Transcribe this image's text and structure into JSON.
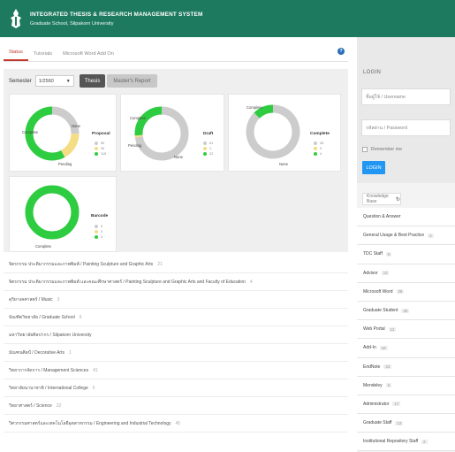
{
  "header": {
    "title": "INTEGRATED THESIS & RESEARCH MANAGEMENT SYSTEM",
    "subtitle": "Graduate School, Silpakorn University"
  },
  "tabs": [
    {
      "label": "Status",
      "active": true
    },
    {
      "label": "Tutorials",
      "active": false
    },
    {
      "label": "Microsoft Word Add On",
      "active": false
    }
  ],
  "toolbar": {
    "semester_label": "Semester",
    "semester_value": "1/2560",
    "thesis_button": "Thesis",
    "masters_button": "Master's Report"
  },
  "colors": {
    "header": "#1e7a5e",
    "complete": "#2ecc40",
    "none": "#cccccc",
    "pending": "#f4dd84",
    "login_button": "#2196f3",
    "active_tab": "#c0392b"
  },
  "chart_data": [
    {
      "type": "pie",
      "title": "Proposal",
      "labels": [
        "None",
        "Pending",
        "Complete"
      ],
      "values": [
        50,
        34,
        115
      ],
      "label_texts": {
        "complete": "Complete",
        "none": "None",
        "pending": "Pending"
      }
    },
    {
      "type": "pie",
      "title": "Draft",
      "labels": [
        "None",
        "Pending",
        "Complete"
      ],
      "values": [
        61,
        1,
        22
      ],
      "label_texts": {
        "complete": "Complete",
        "none": "None",
        "pending": "Pending"
      }
    },
    {
      "type": "pie",
      "title": "Complete",
      "labels": [
        "None",
        "Pending",
        "Complete"
      ],
      "values": [
        28,
        0,
        4
      ],
      "label_texts": {
        "complete": "Complete",
        "none": "None",
        "pending": ""
      }
    },
    {
      "type": "pie",
      "title": "Barcode",
      "labels": [
        "None",
        "Pending",
        "Complete"
      ],
      "values": [
        0,
        0,
        4
      ],
      "label_texts": {
        "complete": "Complete",
        "none": "",
        "pending": ""
      }
    }
  ],
  "departments": [
    {
      "name": "จิตรกรรม ประติมากรรมและภาพพิมพ์ / Painting Sculpture and Graphic Arts",
      "count": "21"
    },
    {
      "name": "จิตรกรรม ประติมากรรมและภาพพิมพ์ และคณะศึกษาศาสตร์ / Painting Sculpture and Graphic Arts and Faculty of Education",
      "count": "4"
    },
    {
      "name": "ดุริยางคศาสตร์ / Music",
      "count": "3"
    },
    {
      "name": "บัณฑิตวิทยาลัย / Graduate School",
      "count": "6"
    },
    {
      "name": "มหาวิทยาลัยศิลปากร / Silpakorn University",
      "count": ""
    },
    {
      "name": "มัณฑนศิลป์ / Decorative Arts",
      "count": "1"
    },
    {
      "name": "วิทยาการจัดการ / Management Sciences",
      "count": "41"
    },
    {
      "name": "วิทยาลัยนานาชาติ / International College",
      "count": "5"
    },
    {
      "name": "วิทยาศาสตร์ / Science",
      "count": "22"
    },
    {
      "name": "วิศวกรรมศาสตร์และเทคโนโลยีอุตสาหกรรม / Engineering and Industrial Technology",
      "count": "45"
    }
  ],
  "login": {
    "title": "LOGIN",
    "username_placeholder": "ชื่อผู้ใช้ / Username",
    "password_placeholder": "รหัสผ่าน / Password",
    "remember_label": "Remember me",
    "button_label": "LOGIN"
  },
  "knowledge_base": {
    "tab_label": "Knowledge Base",
    "items": [
      {
        "label": "Question & Answer",
        "count": ""
      },
      {
        "label": "General Usage & Best Practice",
        "count": "4"
      },
      {
        "label": "TDC Staff",
        "count": "6"
      },
      {
        "label": "Advisor",
        "count": "13"
      },
      {
        "label": "Microsoft Word",
        "count": "28"
      },
      {
        "label": "Graduate Student",
        "count": "39"
      },
      {
        "label": "Web Portal",
        "count": "12"
      },
      {
        "label": "Add-In",
        "count": "18"
      },
      {
        "label": "EndNote",
        "count": "23"
      },
      {
        "label": "Mendeley",
        "count": "6"
      },
      {
        "label": "Administrator",
        "count": "17"
      },
      {
        "label": "Graduate Staff",
        "count": "13"
      },
      {
        "label": "Institutional Repository Staff",
        "count": "2"
      }
    ]
  }
}
